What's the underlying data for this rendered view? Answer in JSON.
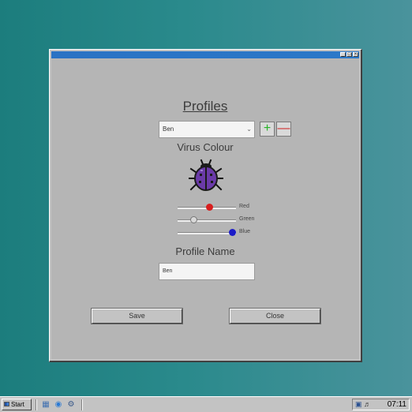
{
  "window": {
    "title_buttons": [
      "_",
      "□",
      "×"
    ]
  },
  "profiles": {
    "title": "Profiles",
    "selected_profile": "Ben",
    "add_label": "+",
    "remove_label": "—"
  },
  "virus_colour": {
    "title": "Virus Colour",
    "bug_color": "#6a3aa8",
    "sliders": {
      "red": {
        "label": "Red",
        "value": 0.56,
        "knob_color": "#d81e1e"
      },
      "green": {
        "label": "Green",
        "value": 0.25,
        "knob_color": "#d8d8d8"
      },
      "blue": {
        "label": "Blue",
        "value": 1.0,
        "knob_color": "#1c1cc8"
      }
    }
  },
  "profile_name": {
    "title": "Profile Name",
    "value": "Ben"
  },
  "buttons": {
    "save": "Save",
    "close": "Close"
  },
  "taskbar": {
    "start_label": "Start",
    "quick_launch": [
      "desktop-icon",
      "browser-icon",
      "settings-icon"
    ],
    "tray_icons": [
      "network-icon",
      "volume-icon"
    ],
    "clock": "07:11"
  }
}
